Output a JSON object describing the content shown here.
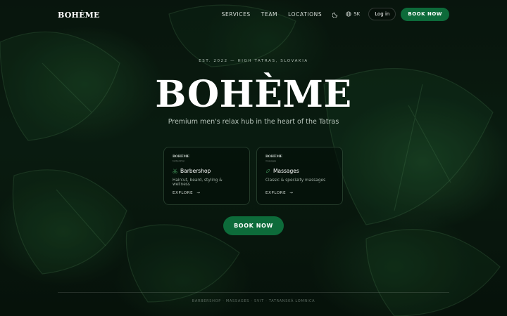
{
  "header": {
    "logo": "BOHÈME",
    "nav": [
      "SERVICES",
      "TEAM",
      "LOCATIONS"
    ],
    "theme_icon": "moon-icon",
    "lang_icon": "globe-icon",
    "language": "SK",
    "login_label": "Log in",
    "book_label": "BOOK NOW"
  },
  "hero": {
    "eyebrow": "EST. 2022 — HIGH TATRAS, SLOVAKIA",
    "title": "BOHÈME",
    "tagline": "Premium men's relax hub in the heart of the Tatras"
  },
  "cards": [
    {
      "mini_logo": "BOHÈME",
      "mini_sub": "barbershop",
      "title": "Barbershop",
      "description": "Haircut, beard, styling & wellness",
      "explore": "EXPLORE",
      "icon": "scissors-icon"
    },
    {
      "mini_logo": "BOHÈME",
      "mini_sub": "massages",
      "title": "Massages",
      "description": "Classic & specialty massages",
      "explore": "EXPLORE",
      "icon": "leaf-icon"
    }
  ],
  "cta_label": "BOOK NOW",
  "footer": "BARBERSHOP · MASSAGES · SVIT · TATRANSKÁ LOMNICA",
  "colors": {
    "accent": "#0d6b3a",
    "background": "#07140c"
  }
}
